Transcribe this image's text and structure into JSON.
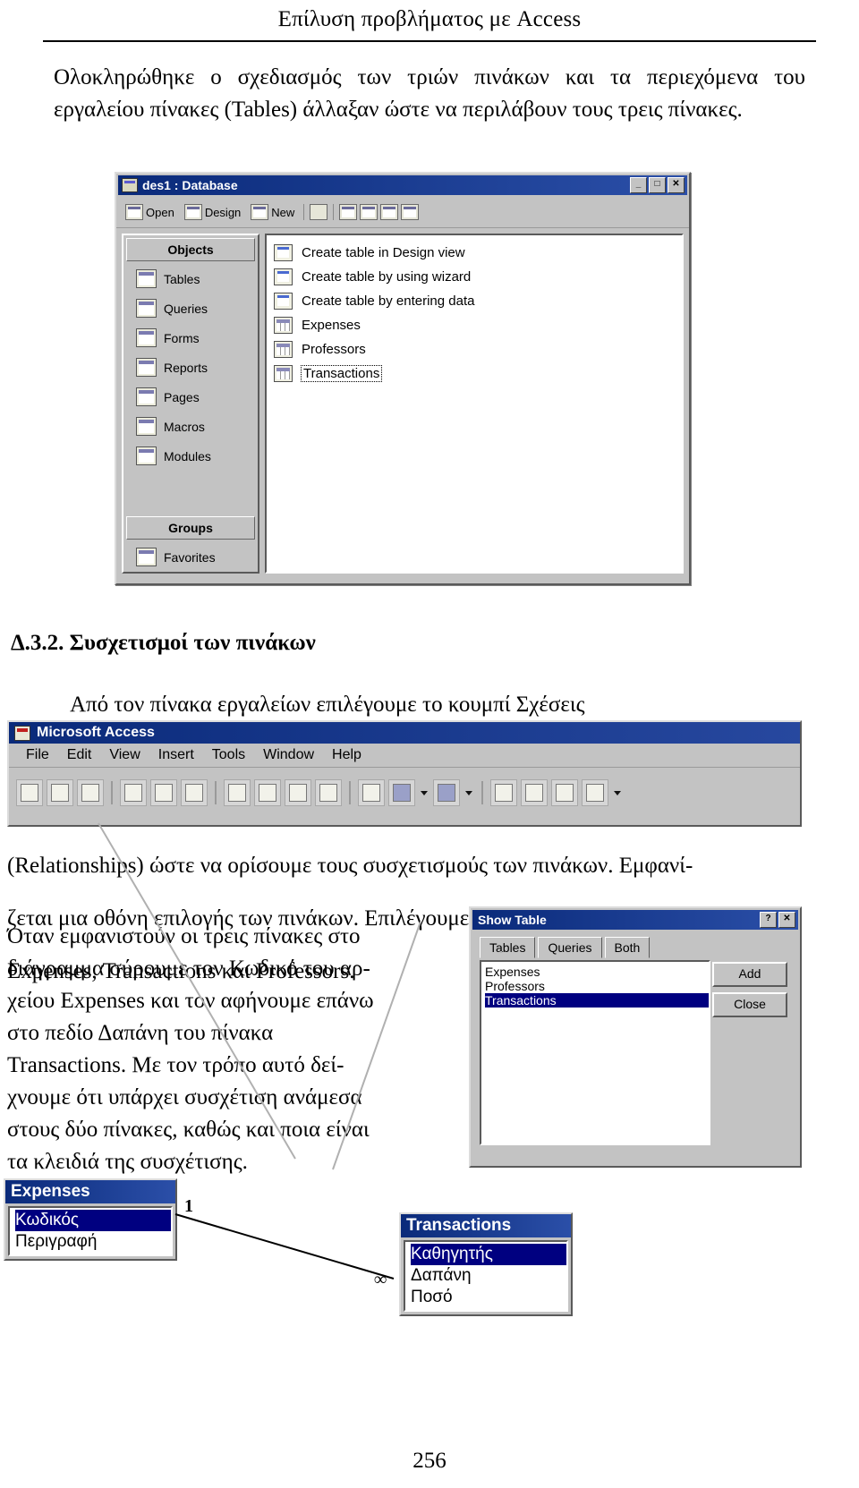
{
  "header": {
    "title": "Επίλυση προβλήματος με Access"
  },
  "intro": {
    "text": "Ολοκληρώθηκε ο σχεδιασμός των τριών πινάκων και τα περιεχόμενα του εργαλείου πίνακες (Tables) άλλαξαν ώστε να περιλάβουν τους τρεις πίνακες."
  },
  "database_window": {
    "title": "des1 : Database",
    "title_icon": "database-icon",
    "window_buttons": [
      "_",
      "□",
      "✕"
    ],
    "toolbar": [
      {
        "label": "Open",
        "icon": "open-icon"
      },
      {
        "label": "Design",
        "icon": "design-icon"
      },
      {
        "label": "New",
        "icon": "new-icon"
      },
      {
        "label": "",
        "icon": "delete-x-icon"
      },
      {
        "label": "",
        "icon": "large-icons-icon"
      },
      {
        "label": "",
        "icon": "small-icons-icon"
      },
      {
        "label": "",
        "icon": "list-view-icon"
      },
      {
        "label": "",
        "icon": "details-view-icon"
      }
    ],
    "objects_header": "Objects",
    "objects": [
      {
        "label": "Tables",
        "icon": "table-icon"
      },
      {
        "label": "Queries",
        "icon": "query-icon"
      },
      {
        "label": "Forms",
        "icon": "form-icon"
      },
      {
        "label": "Reports",
        "icon": "report-icon"
      },
      {
        "label": "Pages",
        "icon": "page-icon"
      },
      {
        "label": "Macros",
        "icon": "macro-icon"
      },
      {
        "label": "Modules",
        "icon": "module-icon"
      }
    ],
    "groups_header": "Groups",
    "groups": [
      {
        "label": "Favorites",
        "icon": "favorites-icon"
      }
    ],
    "list": [
      {
        "label": "Create table in Design view",
        "icon": "new-table-icon",
        "selected": false
      },
      {
        "label": "Create table by using wizard",
        "icon": "new-table-icon",
        "selected": false
      },
      {
        "label": "Create table by entering data",
        "icon": "new-table-icon",
        "selected": false
      },
      {
        "label": "Expenses",
        "icon": "table-icon",
        "selected": false
      },
      {
        "label": "Professors",
        "icon": "table-icon",
        "selected": false
      },
      {
        "label": "Transactions",
        "icon": "table-icon",
        "selected": true
      }
    ]
  },
  "section": {
    "heading": "Δ.3.2. Συσχετισμοί των πινάκων",
    "para1": "Από τον πίνακα εργαλείων επιλέγουμε το κουμπί Σχέσεις"
  },
  "ms_access_window": {
    "title": "Microsoft Access",
    "title_icon": "access-key-icon",
    "menus": [
      "File",
      "Edit",
      "View",
      "Insert",
      "Tools",
      "Window",
      "Help"
    ],
    "toolbar_icons": [
      "new-icon",
      "open-icon",
      "save-icon",
      "print-icon",
      "print-preview-icon",
      "spelling-abc-icon",
      "cut-icon",
      "copy-icon",
      "paste-icon",
      "format-painter-icon",
      "undo-icon",
      "relationships-icon",
      "dropdown-arrow",
      "new-object-icon",
      "dropdown-arrow",
      "code-icon",
      "properties-icon",
      "analyze-icon",
      "office-assistant-icon",
      "dropdown-arrow"
    ]
  },
  "body_text": {
    "line_wide_1": "(Relationships) ώστε να ορίσουμε τους συσχετισμούς των πινάκων. Εμφανί-",
    "line_wide_2": "ζεται μια οθόνη επιλογής των πινάκων. Επιλέγουμε και τους τρεις πίνακες",
    "line_wide_3": "Expenses, Transactions και Professors.",
    "col_lines": [
      "Όταν εμφανιστούν οι τρεις πίνακες στο",
      "διάγραμμα σύρουμε τον Κωδικό του αρ-",
      "χείου Expenses και τον αφήνουμε επάνω",
      "στο πεδίο Δαπάνη του πίνακα",
      "Transactions. Με τον τρόπο αυτό δεί-",
      "χνουμε ότι υπάρχει συσχέτιση ανάμεσα",
      "στους δύο πίνακες, καθώς και ποια είναι",
      "τα κλειδιά της συσχέτισης."
    ]
  },
  "show_table_dialog": {
    "title": "Show Table",
    "help_button": "?",
    "close_button": "✕",
    "tabs": [
      "Tables",
      "Queries",
      "Both"
    ],
    "active_tab": "Tables",
    "items": [
      "Expenses",
      "Professors",
      "Transactions"
    ],
    "selected_item": "Transactions",
    "buttons": [
      "Add",
      "Close"
    ]
  },
  "relationship_diagram": {
    "left_table": {
      "title": "Expenses",
      "fields": [
        "Κωδικός",
        "Περιγραφή"
      ],
      "selected_field": "Κωδικός"
    },
    "right_table": {
      "title": "Transactions",
      "fields": [
        "Καθηγητής",
        "Δαπάνη",
        "Ποσό"
      ],
      "selected_field": "Καθηγητής"
    },
    "left_cardinality": "1",
    "right_cardinality": "∞"
  },
  "page_number": "256"
}
